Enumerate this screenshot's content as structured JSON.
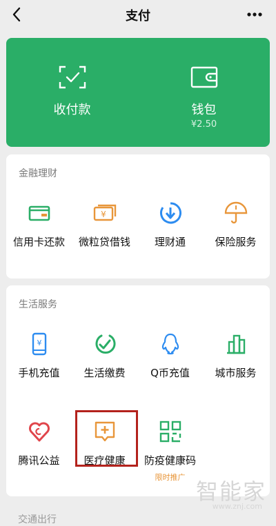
{
  "header": {
    "title": "支付"
  },
  "wallet_panel": {
    "collect_label": "收付款",
    "wallet_label": "钱包",
    "wallet_balance": "¥2.50"
  },
  "finance": {
    "title": "金融理财",
    "items": [
      {
        "label": "信用卡还款",
        "icon": "credit-card-icon"
      },
      {
        "label": "微粒贷借钱",
        "icon": "loan-icon"
      },
      {
        "label": "理财通",
        "icon": "licaitong-icon"
      },
      {
        "label": "保险服务",
        "icon": "insurance-icon"
      }
    ]
  },
  "life": {
    "title": "生活服务",
    "items": [
      {
        "label": "手机充值",
        "icon": "phone-topup-icon"
      },
      {
        "label": "生活缴费",
        "icon": "utility-payment-icon"
      },
      {
        "label": "Q币充值",
        "icon": "qq-coin-icon"
      },
      {
        "label": "城市服务",
        "icon": "city-service-icon"
      },
      {
        "label": "腾讯公益",
        "icon": "charity-icon"
      },
      {
        "label": "医疗健康",
        "icon": "medical-icon"
      },
      {
        "label": "防疫健康码",
        "icon": "health-code-icon",
        "tag": "限时推广"
      }
    ]
  },
  "watermark": {
    "brand": "智能家",
    "url": "www.znj.com"
  },
  "next_section_peek": "交通出行",
  "colors": {
    "green": "#2aae67",
    "icon_green": "#2aae67",
    "icon_orange": "#e8963a",
    "icon_blue": "#2d8cf0",
    "highlight": "#b3221c"
  }
}
